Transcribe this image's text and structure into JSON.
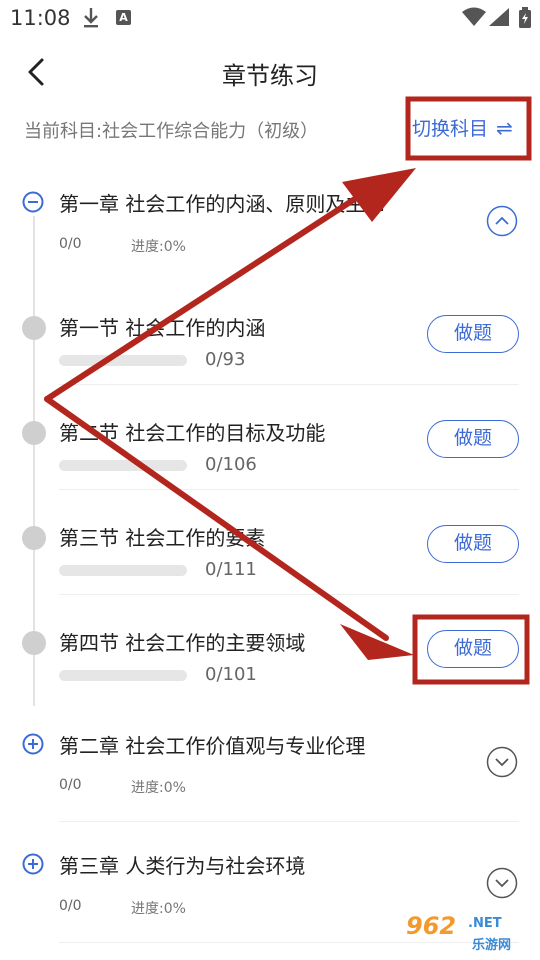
{
  "status_bar": {
    "time": "11:08",
    "app_badge": "A"
  },
  "header": {
    "title": "章节练习"
  },
  "subject": {
    "label": "当前科目:社会工作综合能力（初级）",
    "switch_label": "切换科目",
    "switch_icon": "⇌"
  },
  "chapters": [
    {
      "title": "第一章 社会工作的内涵、原则及主…",
      "count": "0/0",
      "progress": "进度:0%",
      "expanded": true,
      "sections": [
        {
          "title": "第一节 社会工作的内涵",
          "count": "0/93",
          "progress_fraction": 0,
          "button": "做题"
        },
        {
          "title": "第二节 社会工作的目标及功能",
          "count": "0/106",
          "progress_fraction": 0,
          "button": "做题"
        },
        {
          "title": "第三节 社会工作的要素",
          "count": "0/111",
          "progress_fraction": 0,
          "button": "做题"
        },
        {
          "title": "第四节 社会工作的主要领域",
          "count": "0/101",
          "progress_fraction": 0,
          "button": "做题"
        }
      ]
    },
    {
      "title": "第二章 社会工作价值观与专业伦理",
      "count": "0/0",
      "progress": "进度:0%",
      "expanded": false
    },
    {
      "title": "第三章 人类行为与社会环境",
      "count": "0/0",
      "progress": "进度:0%",
      "expanded": false
    }
  ],
  "watermark": {
    "main": "962",
    "net": ".NET",
    "sub": "乐游网"
  },
  "colors": {
    "accent": "#3d6bd6",
    "annotation": "#b3261e",
    "track": "#e6e6e6",
    "dot": "#cfcfcf"
  }
}
